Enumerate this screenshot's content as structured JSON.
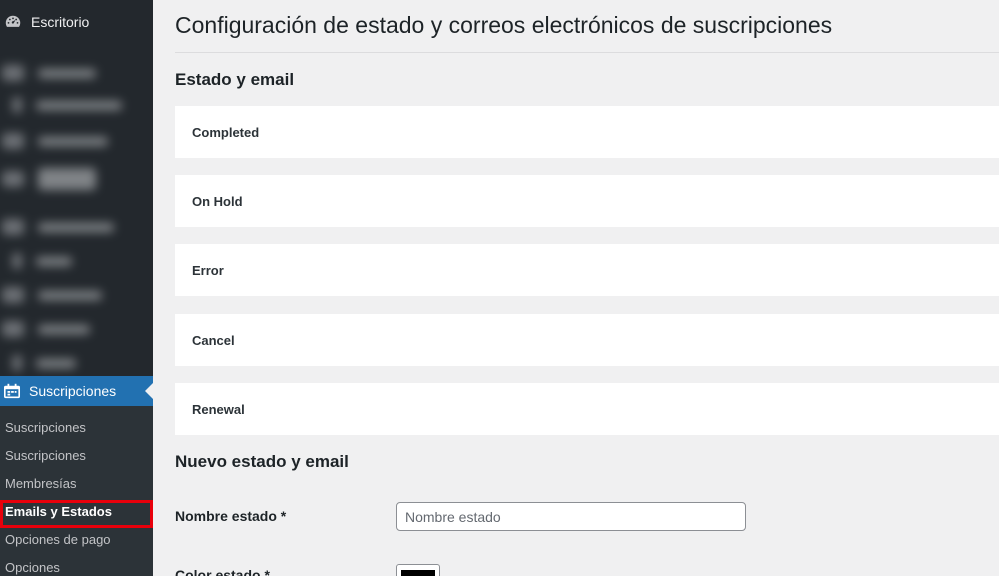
{
  "sidebar": {
    "dashboard_label": "Escritorio",
    "active_menu_label": "Suscripciones",
    "submenu": [
      {
        "label": "Suscripciones",
        "active": false
      },
      {
        "label": "Suscripciones",
        "active": false
      },
      {
        "label": "Membresías",
        "active": false
      },
      {
        "label": "Emails y Estados",
        "active": true
      },
      {
        "label": "Opciones de pago",
        "active": false
      },
      {
        "label": "Opciones",
        "active": false
      }
    ],
    "colors": {
      "background": "#23282d",
      "active": "#2271b1",
      "highlight_border": "#e8000b"
    }
  },
  "main": {
    "page_title": "Configuración de estado y correos electrónicos de suscripciones",
    "status_section_title": "Estado y email",
    "statuses": [
      "Completed",
      "On Hold",
      "Error",
      "Cancel",
      "Renewal"
    ],
    "new_section_title": "Nuevo estado y email",
    "form": {
      "name_label": "Nombre estado *",
      "name_placeholder": "Nombre estado",
      "name_value": "",
      "color_label": "Color estado *",
      "color_value": "#000000"
    }
  }
}
